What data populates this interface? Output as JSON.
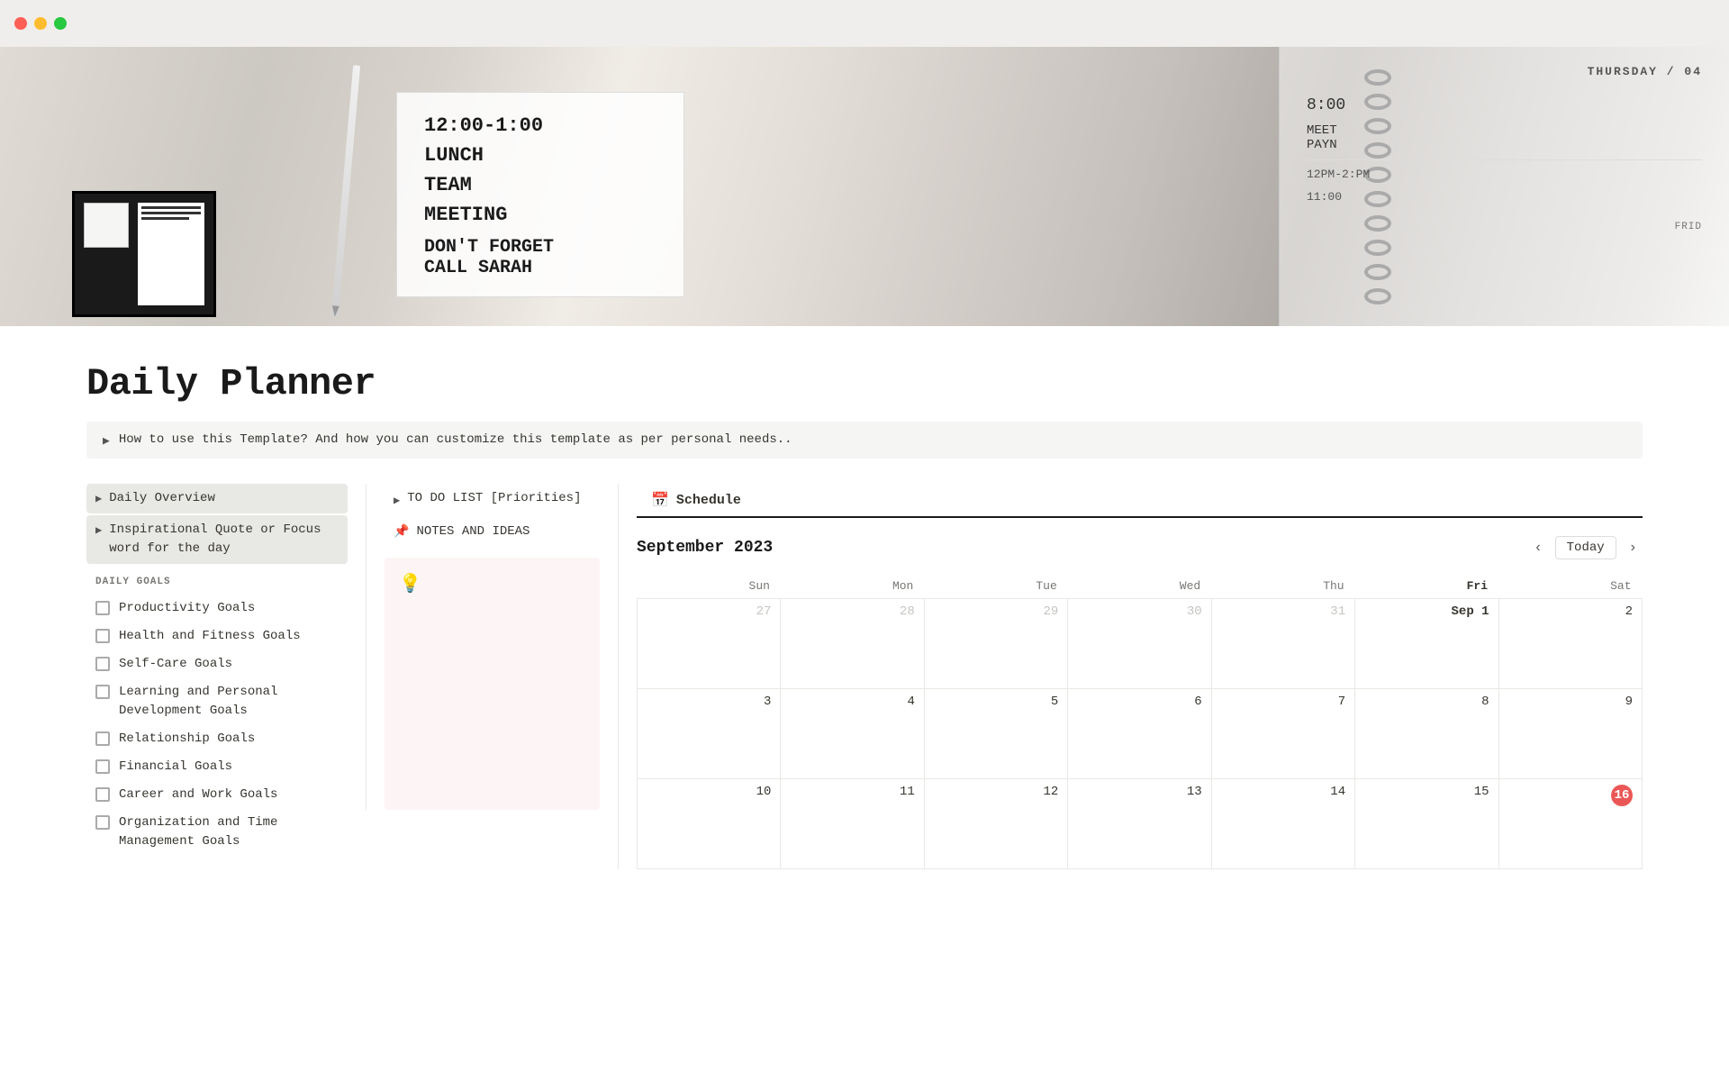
{
  "titlebar": {
    "traffic_lights": [
      "red",
      "yellow",
      "green"
    ]
  },
  "hero": {
    "planner_text_lines": [
      "12:00-1:00",
      "LUNCH",
      "TEAM",
      "MEETING",
      "",
      "DON'T FORGET",
      "CALL SARAH"
    ],
    "calendar_text": "THURSDAY / 04",
    "time_text": "8:00"
  },
  "page": {
    "title": "Daily Planner",
    "callout": {
      "text": "How to use this Template? And how you can customize this template as per personal needs.."
    }
  },
  "left_col": {
    "toggles": [
      {
        "label": "Daily Overview"
      },
      {
        "label": "Inspirational Quote or Focus word for the day"
      }
    ],
    "daily_goals_header": "DAILY GOALS",
    "checkboxes": [
      {
        "label": "Productivity Goals"
      },
      {
        "label": "Health and Fitness Goals"
      },
      {
        "label": "Self-Care Goals"
      },
      {
        "label": "Learning and Personal Development Goals"
      },
      {
        "label": "Relationship Goals"
      },
      {
        "label": "Financial Goals"
      },
      {
        "label": "Career and Work Goals"
      },
      {
        "label": "Organization and Time Management Goals"
      }
    ]
  },
  "middle_col": {
    "todo_label": "TO DO LIST [Priorities]",
    "notes_label": "NOTES AND IDEAS",
    "notes_icon": "📌",
    "bulb_icon": "💡"
  },
  "calendar": {
    "tab_label": "Schedule",
    "tab_icon": "📅",
    "month_year": "September 2023",
    "today_label": "Today",
    "nav_prev": "‹",
    "nav_next": "›",
    "days_of_week": [
      "Sun",
      "Mon",
      "Tue",
      "Wed",
      "Thu",
      "Fri",
      "Sat"
    ],
    "weeks": [
      [
        {
          "num": "27",
          "other": true
        },
        {
          "num": "28",
          "other": true
        },
        {
          "num": "29",
          "other": true
        },
        {
          "num": "30",
          "other": true
        },
        {
          "num": "31",
          "other": true
        },
        {
          "num": "Sep 1",
          "sep1": true
        },
        {
          "num": "2"
        }
      ],
      [
        {
          "num": "3"
        },
        {
          "num": "4"
        },
        {
          "num": "5"
        },
        {
          "num": "6"
        },
        {
          "num": "7"
        },
        {
          "num": "8"
        },
        {
          "num": "9"
        }
      ],
      [
        {
          "num": "10"
        },
        {
          "num": "11"
        },
        {
          "num": "12"
        },
        {
          "num": "13"
        },
        {
          "num": "14"
        },
        {
          "num": "15"
        },
        {
          "num": "16",
          "today": true
        }
      ]
    ]
  }
}
